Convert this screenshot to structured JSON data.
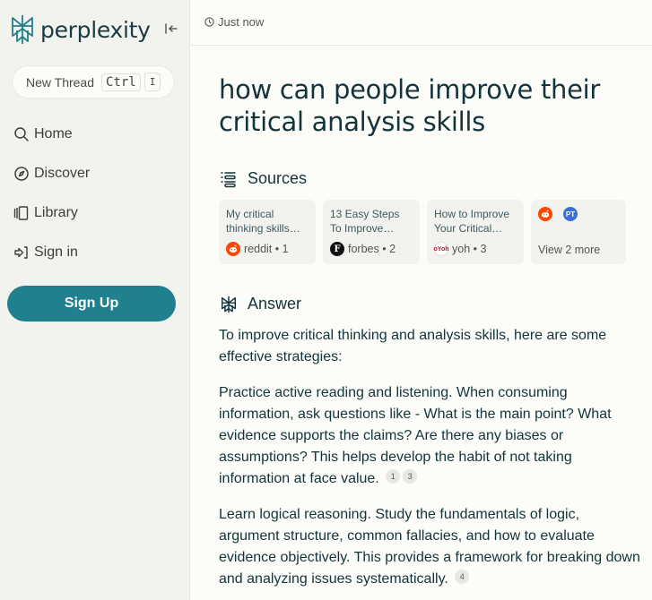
{
  "sidebar": {
    "brand": "perplexity",
    "brand_color": "#20808d",
    "collapse_icon": "collapse-sidebar-icon",
    "new_thread": {
      "label": "New Thread",
      "shortcut_keys": [
        "Ctrl",
        "I"
      ]
    },
    "nav_items": [
      {
        "label": "Home",
        "icon": "search-icon"
      },
      {
        "label": "Discover",
        "icon": "compass-icon"
      },
      {
        "label": "Library",
        "icon": "library-icon"
      },
      {
        "label": "Sign in",
        "icon": "sign-in-icon"
      }
    ],
    "signup_label": "Sign Up"
  },
  "header": {
    "timestamp": "Just now",
    "timestamp_icon": "clock-icon"
  },
  "thread": {
    "question": "how can people improve their critical analysis skills",
    "sources_heading": "Sources",
    "sources": [
      {
        "title": "My critical thinking skills…",
        "site": "reddit",
        "index": "1",
        "meta": "reddit • 1"
      },
      {
        "title": "13 Easy Steps To Improve…",
        "site": "forbes",
        "index": "2",
        "meta": "forbes • 2"
      },
      {
        "title": "How to Improve Your Critical…",
        "site": "yoh",
        "index": "3",
        "meta": "yoh • 3"
      }
    ],
    "more_sources": {
      "label": "View 2 more",
      "icons": [
        "reddit",
        "PT"
      ]
    },
    "answer_heading": "Answer",
    "answer_paragraphs": [
      {
        "text": "To improve critical thinking and analysis skills, here are some effective strategies:",
        "citations": []
      },
      {
        "text": "Practice active reading and listening. When consuming information, ask questions like - What is the main point? What evidence supports the claims? Are there any biases or assumptions? This helps develop the habit of not taking information at face value.",
        "citations": [
          "1",
          "3"
        ]
      },
      {
        "text": "Learn logical reasoning. Study the fundamentals of logic, argument structure, common fallacies, and how to evaluate evidence objectively. This provides a framework for breaking down and analyzing issues systematically.",
        "citations": [
          "4"
        ]
      }
    ]
  },
  "favicons": {
    "forbes_letter": "F",
    "yoh_text": "oYoh",
    "pt_text": "PT"
  }
}
